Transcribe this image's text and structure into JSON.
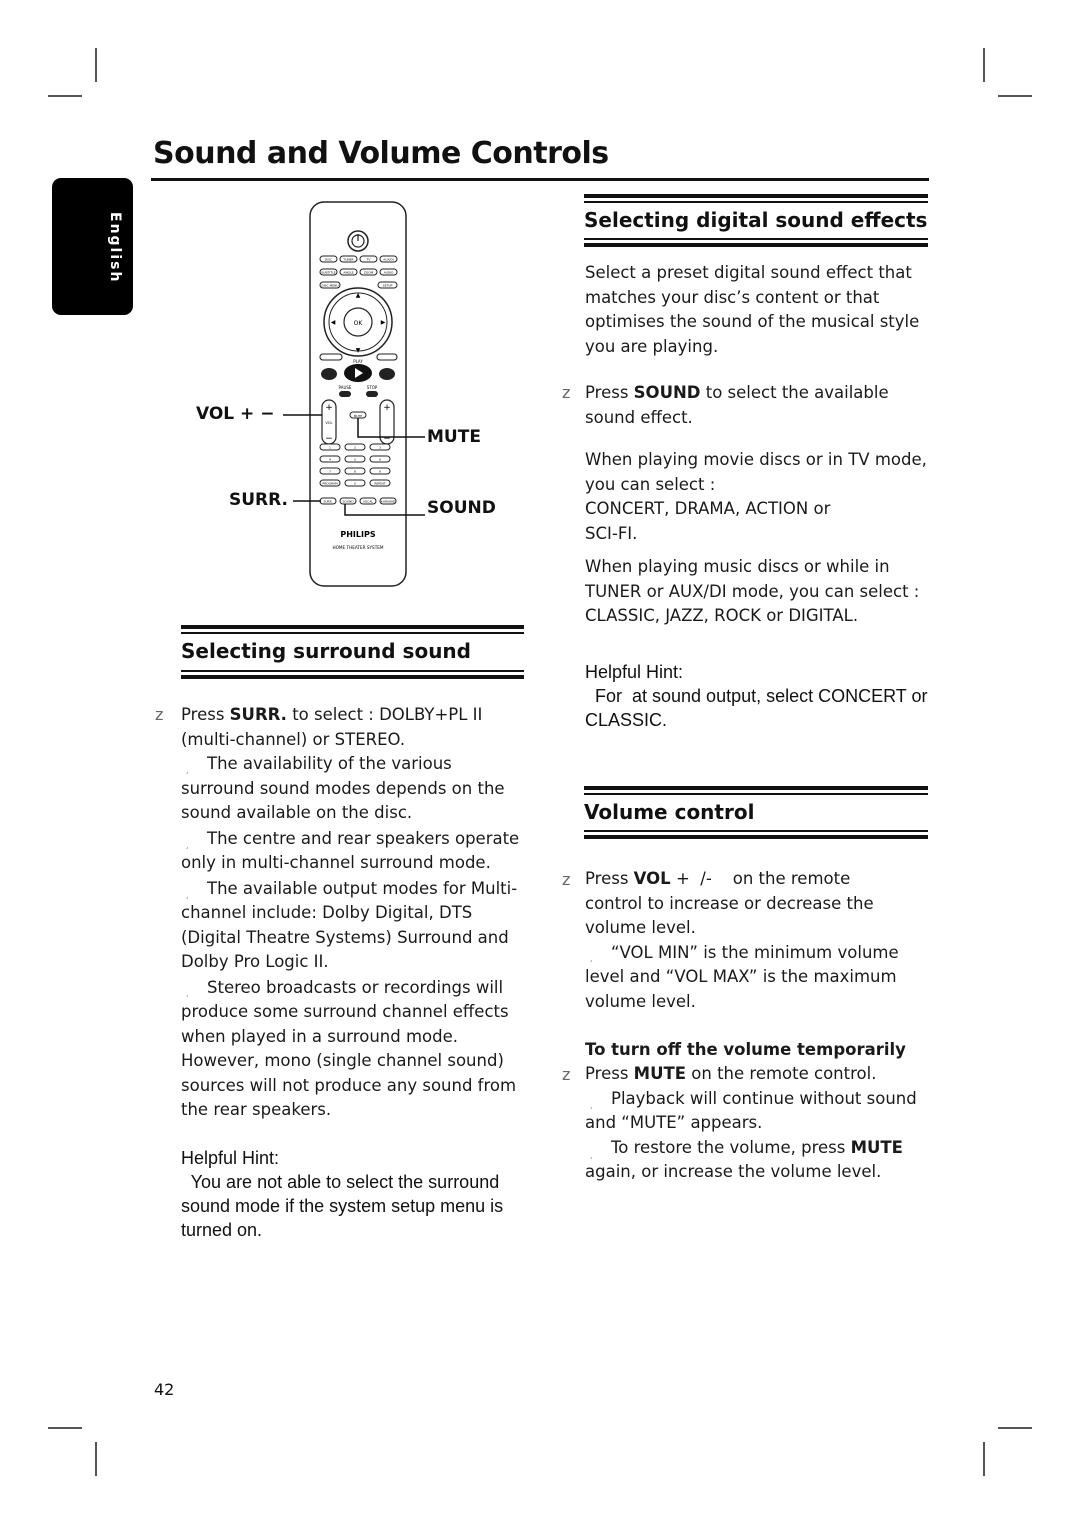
{
  "page": {
    "title": "Sound and Volume Controls",
    "language_tab": "English",
    "page_number": "42"
  },
  "remote": {
    "brand": "PHILIPS",
    "subtitle": "HOME THEATER SYSTEM",
    "row1": [
      "DISC",
      "TUNER",
      "TV",
      "AUX/DI"
    ],
    "row2": [
      "SUBTITLE",
      "ANGLE",
      "ZOOM",
      "AUDIO"
    ],
    "menu_left": "DISC MENU",
    "menu_right": "SETUP",
    "ok": "OK",
    "return_label": "RETURN/TITLE",
    "display_label": "DISPLAY",
    "play_label": "PLAY",
    "pause_label": "PAUSE",
    "stop_label": "STOP",
    "mute_btn": "MUTE",
    "vol_label": "VOL",
    "tvvol_label": "TV VOL",
    "numbers": [
      "1",
      "2",
      "3",
      "4",
      "5",
      "6",
      "7",
      "8",
      "9",
      "PROGRAM",
      "0",
      "REPEAT"
    ],
    "bottom_row": [
      "SURR.",
      "SOUND",
      "VOCAL",
      "KARAOKE"
    ],
    "callouts": {
      "vol": "VOL + −",
      "mute": "MUTE",
      "surr": "SURR.",
      "sound": "SOUND"
    }
  },
  "surround": {
    "heading": "Selecting surround sound",
    "bullet_marker": "z",
    "sub_marker": "¸",
    "step_pre": "Press ",
    "step_key": "SURR.",
    "step_line1_post": " to select : DOLBY+PL II",
    "step_line2": "(multi-channel) or STEREO.",
    "notes": [
      [
        "The availability of the various",
        "surround sound modes depends on the",
        "sound available on the disc."
      ],
      [
        "The centre and rear speakers operate",
        "only in multi-channel surround mode."
      ],
      [
        "The available output modes for Multi-",
        "channel include: Dolby Digital, DTS",
        "(Digital Theatre Systems) Surround and",
        "Dolby Pro Logic II."
      ],
      [
        "Stereo broadcasts or recordings will",
        "produce some surround channel effects",
        "when played in a surround mode.",
        "However, mono (single channel sound)",
        "sources will not produce any sound from",
        "the rear speakers."
      ]
    ],
    "hint_title": "Helpful Hint:",
    "hint_lines": [
      "  You are not able to select the surround",
      "sound mode if the system setup menu is",
      "turned on."
    ]
  },
  "effects": {
    "heading": "Selecting digital sound effects",
    "intro": [
      "Select a preset digital sound effect that",
      "matches your disc’s content or that",
      "optimises the sound of the musical style",
      "you are playing."
    ],
    "step_pre": "Press ",
    "step_key": "SOUND",
    "step_post": " to select the available",
    "step_line2": "sound effect.",
    "movie": [
      "When playing movie discs or in TV mode,",
      "you can select :",
      "CONCERT, DRAMA, ACTION or",
      "SCI-FI."
    ],
    "music": [
      "When playing music discs or while in",
      "TUNER or AUX/DI mode, you can select :",
      "CLASSIC, JAZZ, ROCK or DIGITAL."
    ],
    "hint_title": "Helpful Hint:",
    "hint_lines": [
      "  For  at sound output, select CONCERT or",
      "CLASSIC."
    ]
  },
  "volume": {
    "heading": "Volume control",
    "step_pre": "Press ",
    "step_key": "VOL",
    "step_post": " +  /-    on the remote",
    "step_lines": [
      "control to increase or decrease the",
      "volume level."
    ],
    "note": [
      "“VOL MIN” is the minimum volume",
      "level and “VOL MAX” is the maximum",
      "volume level."
    ],
    "subheading": "To turn off the volume temporarily",
    "mute_pre": "Press ",
    "mute_key": "MUTE",
    "mute_post": " on the remote control.",
    "mute_note1": [
      "Playback will continue without sound",
      "and “MUTE” appears."
    ],
    "mute_note2_pre": "To restore the volume, press ",
    "mute_note2_key": "MUTE",
    "mute_note2_line2": "again, or increase the volume level."
  }
}
